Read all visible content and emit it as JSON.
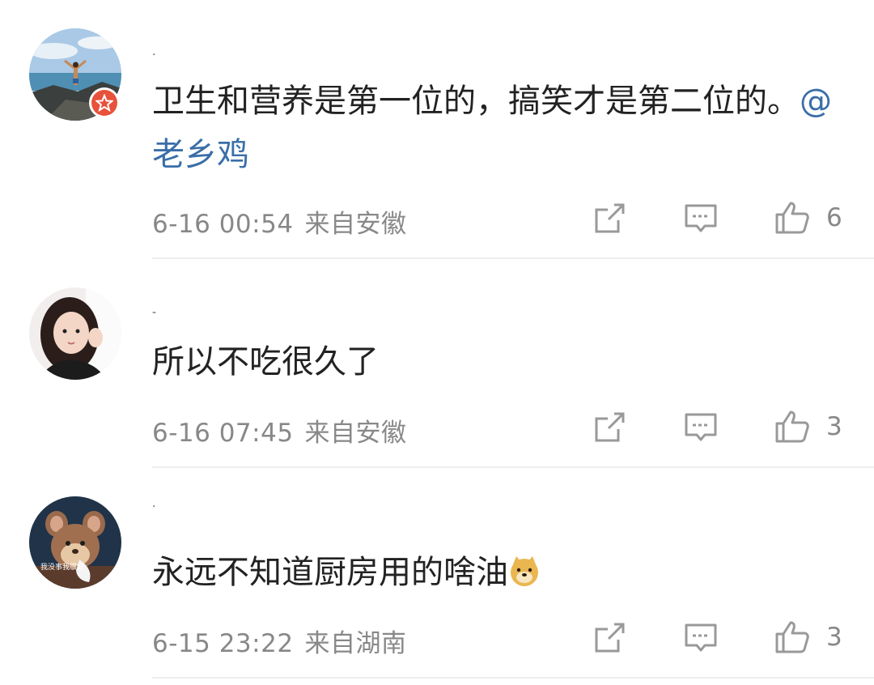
{
  "comments": [
    {
      "username": "·",
      "text": "卫生和营养是第一位的，搞笑才是第二位的。",
      "mention": "@老乡鸡",
      "date": "6-16 00:54",
      "location": "来自安徽",
      "likes": "6"
    },
    {
      "username": "-",
      "text": "所以不吃很久了",
      "date": "6-16 07:45",
      "location": "来自安徽",
      "likes": "3"
    },
    {
      "username": "·",
      "text": "永远不知道厨房用的啥油",
      "emoji": "doge-emoji",
      "date": "6-15 23:22",
      "location": "来自湖南",
      "likes": "3",
      "avatar_caption": "我没事我很好"
    }
  ],
  "colors": {
    "accent_link": "#3a6ea8",
    "meta": "#888888",
    "badge": "#e8513a"
  }
}
